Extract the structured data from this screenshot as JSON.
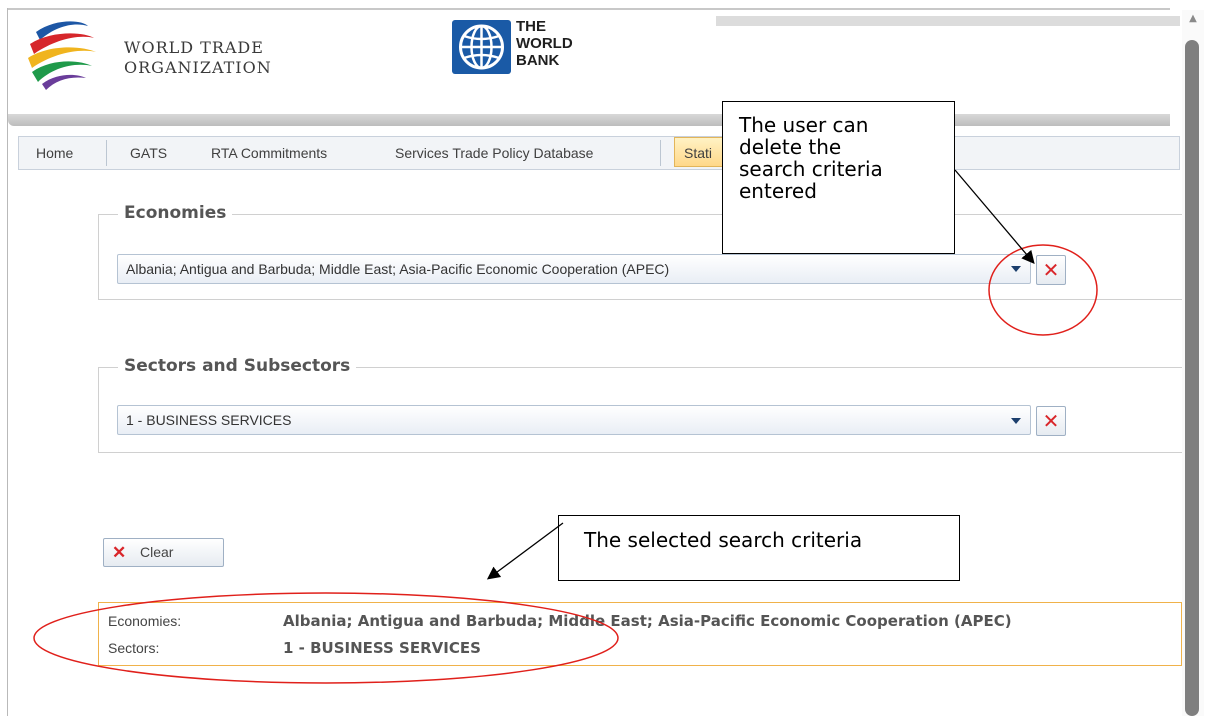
{
  "header": {
    "wto_line1": "WORLD TRADE",
    "wto_line2": "ORGANIZATION",
    "wb_line1": "THE",
    "wb_line2": "WORLD",
    "wb_line3": "BANK"
  },
  "nav": {
    "items": [
      "Home",
      "GATS",
      "RTA Commitments",
      "Services Trade Policy Database",
      "Stati"
    ]
  },
  "economies": {
    "title": "Economies",
    "value": "Albania; Antigua and Barbuda; Middle East; Asia-Pacific Economic Cooperation (APEC)"
  },
  "sectors": {
    "title": "Sectors and Subsectors",
    "value": "1 - BUSINESS SERVICES"
  },
  "clear_button": {
    "label": "Clear"
  },
  "summary": {
    "economies_label": "Economies:",
    "economies_value": "Albania; Antigua and Barbuda; Middle East; Asia-Pacific Economic Cooperation (APEC)",
    "sectors_label": "Sectors:",
    "sectors_value": "1 - BUSINESS SERVICES"
  },
  "callouts": {
    "delete_lines": [
      "The user can",
      "delete the",
      "search criteria",
      "entered"
    ],
    "selected": "The selected search criteria"
  },
  "colors": {
    "annotation_red": "#e0201b",
    "delete_red": "#d9262a",
    "summary_border": "#f0b24a",
    "nav_active": "#ffd88a",
    "worldbank_blue": "#1a5aa6"
  },
  "icons": [
    "wto-logo-icon",
    "globe-icon",
    "dropdown-arrow-icon",
    "delete-x-icon",
    "scroll-up-icon"
  ]
}
